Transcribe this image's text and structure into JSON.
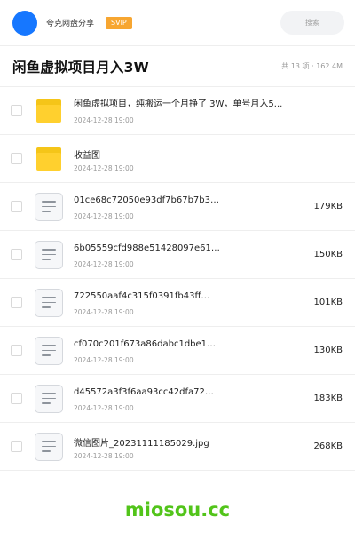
{
  "header": {
    "user_name": "夸克网盘分享",
    "badge": "SVIP",
    "search_placeholder": "搜索",
    "colors": {
      "avatar": "#1677ff",
      "badge": "#f7a631"
    }
  },
  "share": {
    "title": "闲鱼虚拟项目月入3W",
    "meta": "共 13 项 · 162.4M"
  },
  "files": [
    {
      "type": "folder",
      "name": "闲鱼虚拟项目，纯搬运一个月挣了 3W，单号月入5...",
      "date": "2024-12-28 19:00",
      "size": ""
    },
    {
      "type": "folder",
      "name": "收益图",
      "date": "2024-12-28 19:00",
      "size": ""
    },
    {
      "type": "file",
      "name": "01ce68c72050e93df7b67b7b3…",
      "date": "2024-12-28 19:00",
      "size": "179KB"
    },
    {
      "type": "file",
      "name": "6b05559cfd988e51428097e61…",
      "date": "2024-12-28 19:00",
      "size": "150KB"
    },
    {
      "type": "file",
      "name": "722550aaf4c315f0391fb43ff…",
      "date": "2024-12-28 19:00",
      "size": "101KB"
    },
    {
      "type": "file",
      "name": "cf070c201f673a86dabc1dbe1…",
      "date": "2024-12-28 19:00",
      "size": "130KB"
    },
    {
      "type": "file",
      "name": "d45572a3f3f6aa93cc42dfa72…",
      "date": "2024-12-28 19:00",
      "size": "183KB"
    },
    {
      "type": "file",
      "name": "微信图片_20231111185029.jpg",
      "date": "2024-12-28 19:00",
      "size": "268KB"
    }
  ],
  "watermark": "miosou.cc"
}
